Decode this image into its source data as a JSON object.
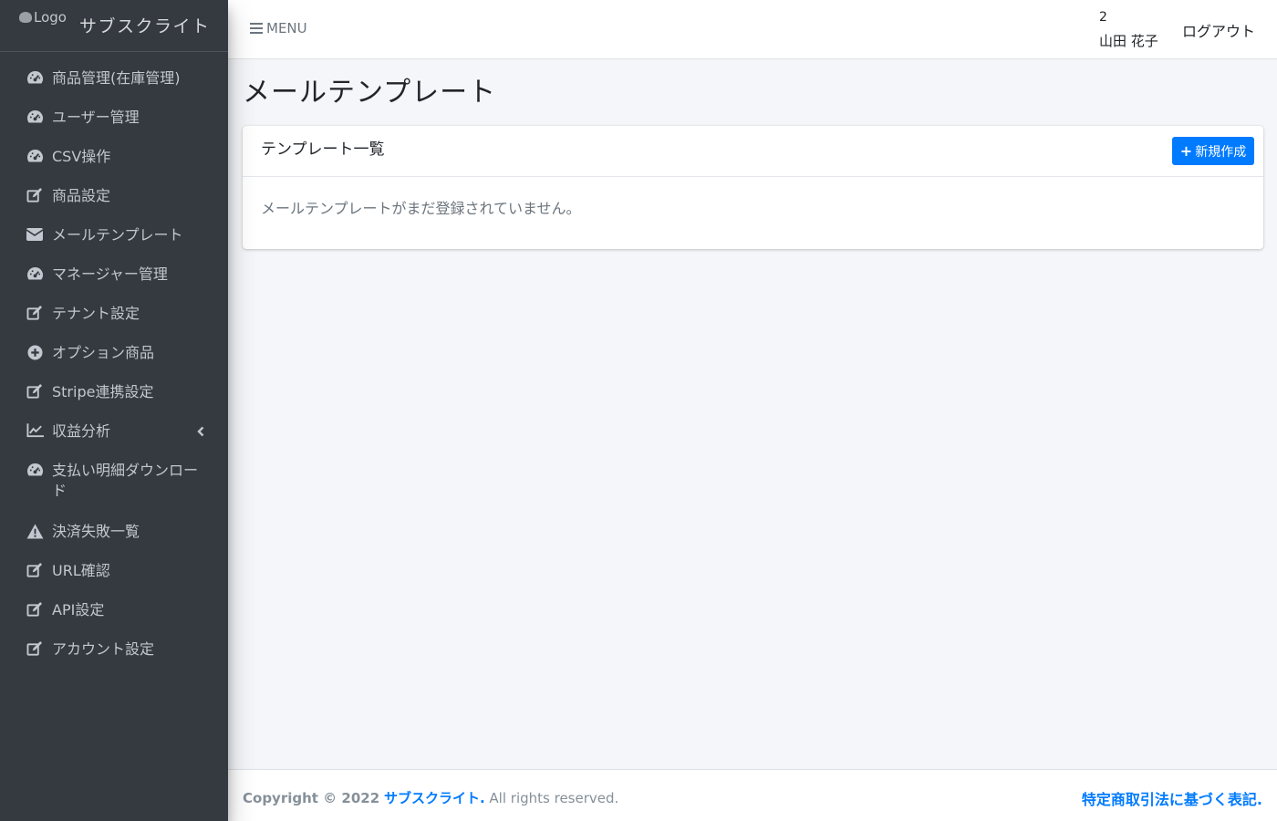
{
  "sidebar": {
    "logo_alt": "Logo",
    "brand": "サブスクライト",
    "items": [
      {
        "label": "商品管理(在庫管理)",
        "icon": "dashboard-gauge-icon"
      },
      {
        "label": "ユーザー管理",
        "icon": "dashboard-gauge-icon"
      },
      {
        "label": "CSV操作",
        "icon": "dashboard-gauge-icon"
      },
      {
        "label": "商品設定",
        "icon": "edit-icon"
      },
      {
        "label": "メールテンプレート",
        "icon": "envelope-icon"
      },
      {
        "label": "マネージャー管理",
        "icon": "dashboard-gauge-icon"
      },
      {
        "label": "テナント設定",
        "icon": "edit-icon"
      },
      {
        "label": "オプション商品",
        "icon": "plus-circle-icon"
      },
      {
        "label": "Stripe連携設定",
        "icon": "edit-icon"
      },
      {
        "label": "収益分析",
        "icon": "line-chart-icon"
      },
      {
        "label": "支払い明細ダウンロード",
        "icon": "dashboard-gauge-icon"
      },
      {
        "label": "決済失敗一覧",
        "icon": "warning-icon"
      },
      {
        "label": "URL確認",
        "icon": "edit-icon"
      },
      {
        "label": "API設定",
        "icon": "edit-icon"
      },
      {
        "label": "アカウント設定",
        "icon": "edit-icon"
      }
    ]
  },
  "header": {
    "menu_label": "MENU",
    "user_id": "2",
    "user_name": "山田 花子",
    "logout_label": "ログアウト"
  },
  "main": {
    "page_title": "メールテンプレート",
    "card_title": "テンプレート一覧",
    "new_button_label": "新規作成",
    "empty_message": "メールテンプレートがまだ登録されていません。"
  },
  "footer": {
    "copyright_prefix": "Copyright © 2022",
    "brand_link": "サブスクライト.",
    "rights": "All rights reserved.",
    "legal_link": "特定商取引法に基づく表記."
  },
  "colors": {
    "sidebar_bg": "#343a40",
    "accent": "#007bff",
    "page_bg": "#f4f6f9"
  }
}
